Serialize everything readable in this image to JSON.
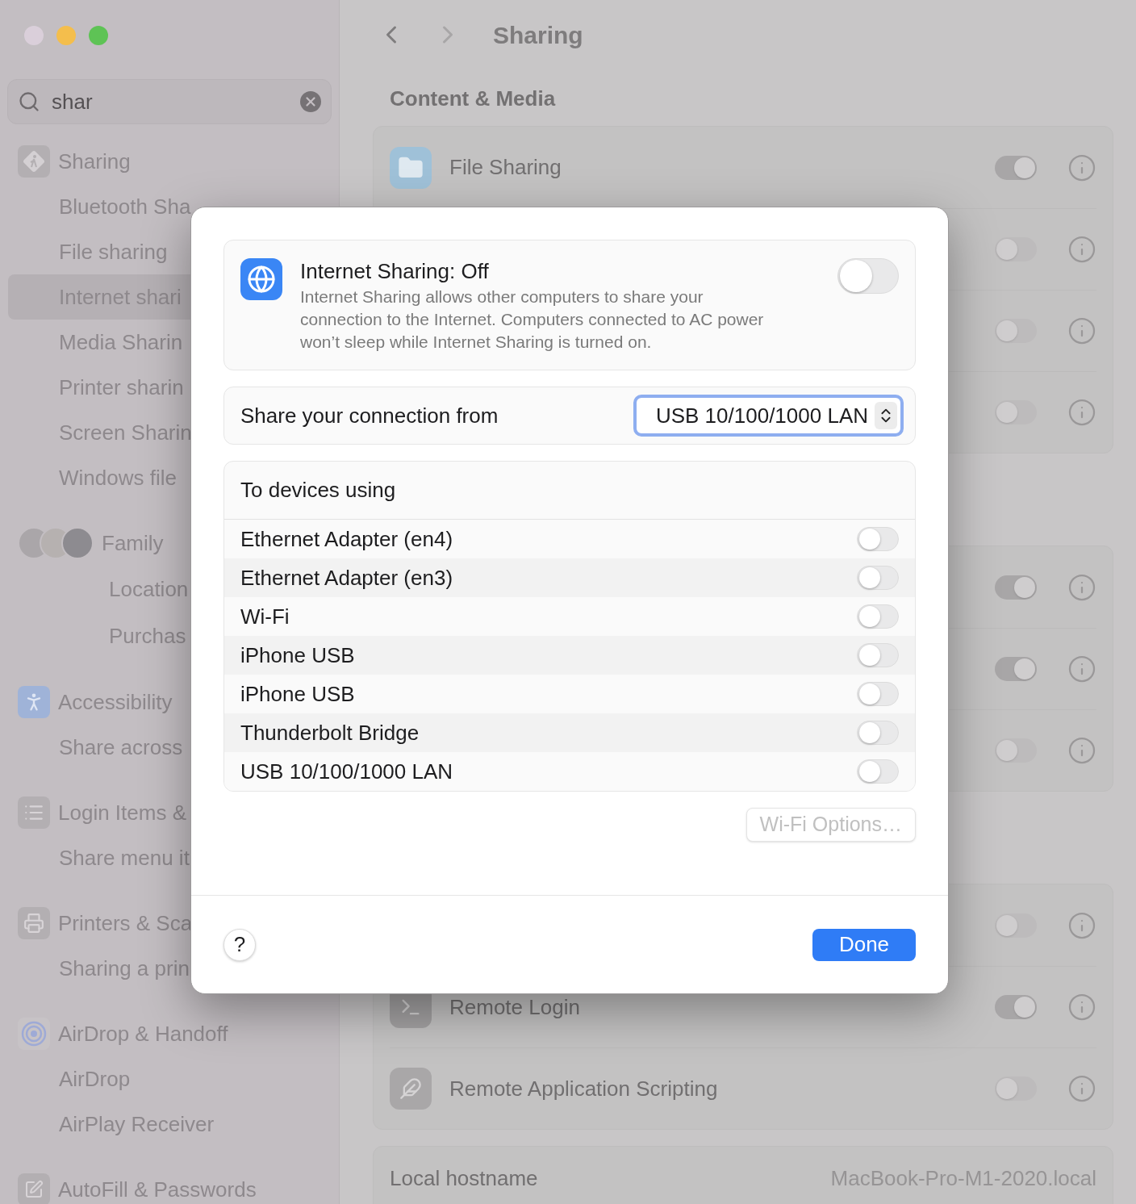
{
  "window": {
    "controls": [
      {
        "color": "#dacfda"
      },
      {
        "color": "#f4be4c"
      },
      {
        "color": "#5ec355"
      }
    ]
  },
  "sidebar": {
    "search": {
      "value": "shar"
    },
    "items": [
      {
        "label": "Sharing",
        "kind": "sharing",
        "selected": false,
        "children": [
          {
            "label": "Bluetooth Sha",
            "selected": false
          },
          {
            "label": "File sharing",
            "selected": false
          },
          {
            "label": "Internet shari",
            "selected": true
          },
          {
            "label": "Media Sharin",
            "selected": false
          },
          {
            "label": "Printer sharin",
            "selected": false
          },
          {
            "label": "Screen Sharin",
            "selected": false
          },
          {
            "label": "Windows file",
            "selected": false
          }
        ]
      },
      {
        "label": "Family",
        "kind": "family",
        "selected": false,
        "children": [
          {
            "label": "Location",
            "selected": false
          },
          {
            "label": "Purchas",
            "selected": false
          }
        ]
      },
      {
        "label": "Accessibility",
        "kind": "accessibility",
        "selected": false,
        "children": [
          {
            "label": "Share across",
            "selected": false
          }
        ]
      },
      {
        "label": "Login Items &",
        "kind": "login",
        "selected": false,
        "children": [
          {
            "label": "Share menu it",
            "selected": false
          }
        ]
      },
      {
        "label": "Printers & Sca",
        "kind": "printer",
        "selected": false,
        "children": [
          {
            "label": "Sharing a prin",
            "selected": false
          }
        ]
      },
      {
        "label": "AirDrop & Handoff",
        "kind": "airdrop",
        "selected": false,
        "children": [
          {
            "label": "AirDrop",
            "selected": false
          },
          {
            "label": "AirPlay Receiver",
            "selected": false
          }
        ]
      },
      {
        "label": "AutoFill & Passwords",
        "kind": "autofill",
        "selected": false
      }
    ]
  },
  "toolbar": {
    "back": {
      "disabled": false
    },
    "forward": {
      "disabled": true
    },
    "title": "Sharing"
  },
  "section_title": "Content & Media",
  "groups": [
    {
      "rows": [
        {
          "label": "File Sharing",
          "kind": "folder",
          "on": true
        },
        {
          "on": false
        },
        {
          "on": false
        },
        {
          "on": false
        }
      ]
    },
    {
      "rows": [
        {
          "on": true
        },
        {
          "on": true
        },
        {
          "on": false
        }
      ]
    },
    {
      "rows": [
        {
          "on": false
        },
        {
          "label": "Remote Login",
          "kind": "terminal",
          "on": true
        },
        {
          "label": "Remote Application Scripting",
          "kind": "script",
          "on": false
        }
      ]
    }
  ],
  "hostname": {
    "label": "Local hostname",
    "value": "MacBook-Pro-M1-2020.local"
  },
  "dialog": {
    "header": {
      "title": "Internet Sharing: Off",
      "description": "Internet Sharing allows other computers to share your connection to the Internet. Computers connected to AC power won’t sleep while Internet Sharing is turned on.",
      "on": false
    },
    "source": {
      "label": "Share your connection from",
      "value": "USB 10/100/1000 LAN"
    },
    "devices": {
      "title": "To devices using",
      "items": [
        {
          "label": "Ethernet Adapter (en4)",
          "on": false
        },
        {
          "label": "Ethernet Adapter (en3)",
          "on": false
        },
        {
          "label": "Wi-Fi",
          "on": false
        },
        {
          "label": "iPhone USB",
          "on": false
        },
        {
          "label": "iPhone USB",
          "on": false
        },
        {
          "label": "Thunderbolt Bridge",
          "on": false
        },
        {
          "label": "USB 10/100/1000 LAN",
          "on": false
        }
      ]
    },
    "wifi_options": {
      "label": "Wi-Fi Options…",
      "disabled": true
    },
    "help": "?",
    "done": "Done"
  }
}
